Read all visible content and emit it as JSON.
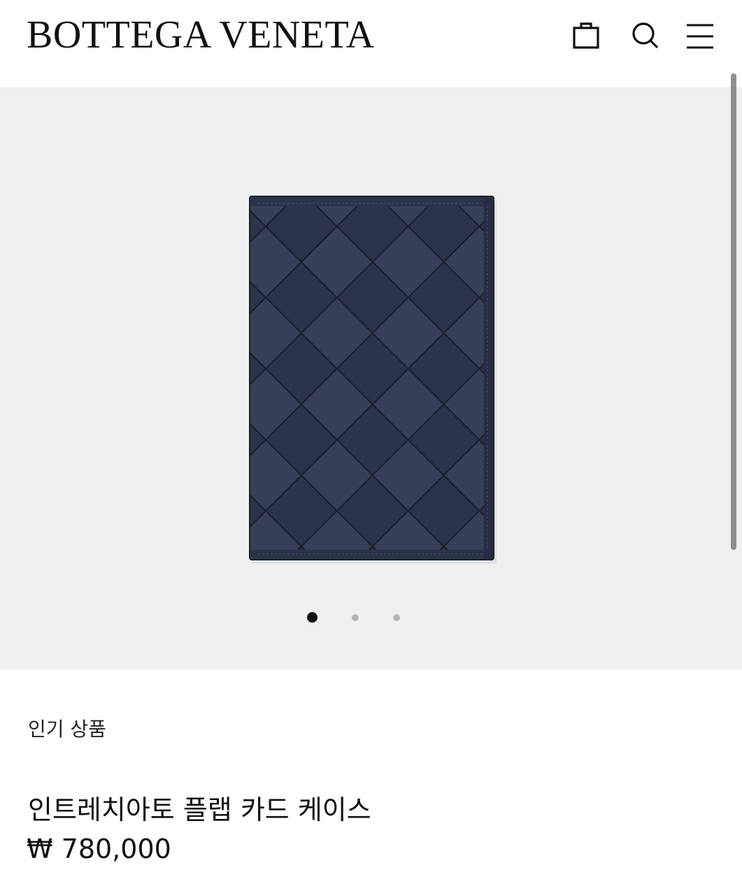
{
  "header": {
    "logo": "BOTTEGA VENETA",
    "icons": [
      "shopping-bag-icon",
      "search-icon",
      "menu-icon"
    ]
  },
  "gallery": {
    "image_description": "navy intrecciato woven leather card case",
    "image_color": "#2a3147",
    "background_color": "#eff0ef",
    "slide_count": 3,
    "active_slide": 1
  },
  "product": {
    "badge": "인기 상품",
    "name": "인트레치아토 플랩 카드 케이스",
    "price": "₩ 780,000"
  }
}
